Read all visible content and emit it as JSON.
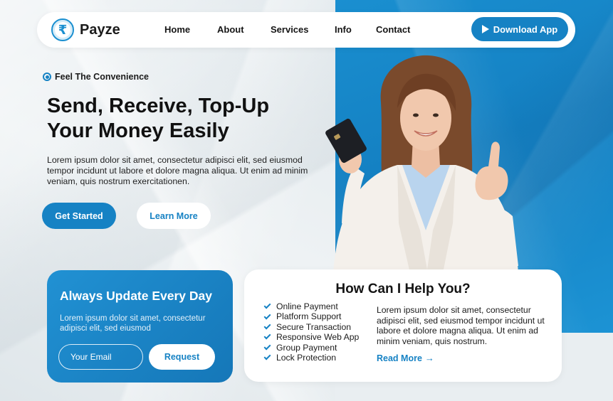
{
  "brand": {
    "name": "Payze",
    "logo_symbol": "₹"
  },
  "nav": {
    "links": [
      "Home",
      "About",
      "Services",
      "Info",
      "Contact"
    ],
    "download_label": "Download App"
  },
  "hero": {
    "eyebrow": "Feel The Convenience",
    "title_line1": "Send, Receive, Top-Up",
    "title_line2": "Your Money Easily",
    "description": "Lorem ipsum dolor sit amet, consectetur adipisci elit, sed eiusmod tempor incidunt ut labore et dolore magna aliqua. Ut enim ad minim veniam, quis nostrum exercitationen.",
    "primary_cta": "Get Started",
    "secondary_cta": "Learn More"
  },
  "subscribe": {
    "title": "Always Update Every Day",
    "description": "Lorem ipsum dolor sit amet, consectetur adipisci elit, sed eiusmod",
    "email_placeholder": "Your Email",
    "button_label": "Request"
  },
  "help": {
    "title": "How Can I Help You?",
    "features": [
      "Online Payment",
      "Platform Support",
      "Secure Transaction",
      "Responsive Web App",
      "Group Payment",
      "Lock Protection"
    ],
    "description": "Lorem ipsum dolor sit amet, consectetur adipisci elit, sed eiusmod tempor incidunt ut labore et dolore magna aliqua. Ut enim ad minim veniam, quis nostrum.",
    "read_more": "Read More"
  },
  "colors": {
    "primary": "#1682c4",
    "background": "#e9eef1",
    "dark_text": "#141414"
  },
  "icons": {
    "logo": "rupee-coin-icon",
    "download": "play-icon",
    "eyebrow": "radio-dot-icon",
    "feature": "check-icon",
    "read_more": "arrow-right-icon"
  }
}
